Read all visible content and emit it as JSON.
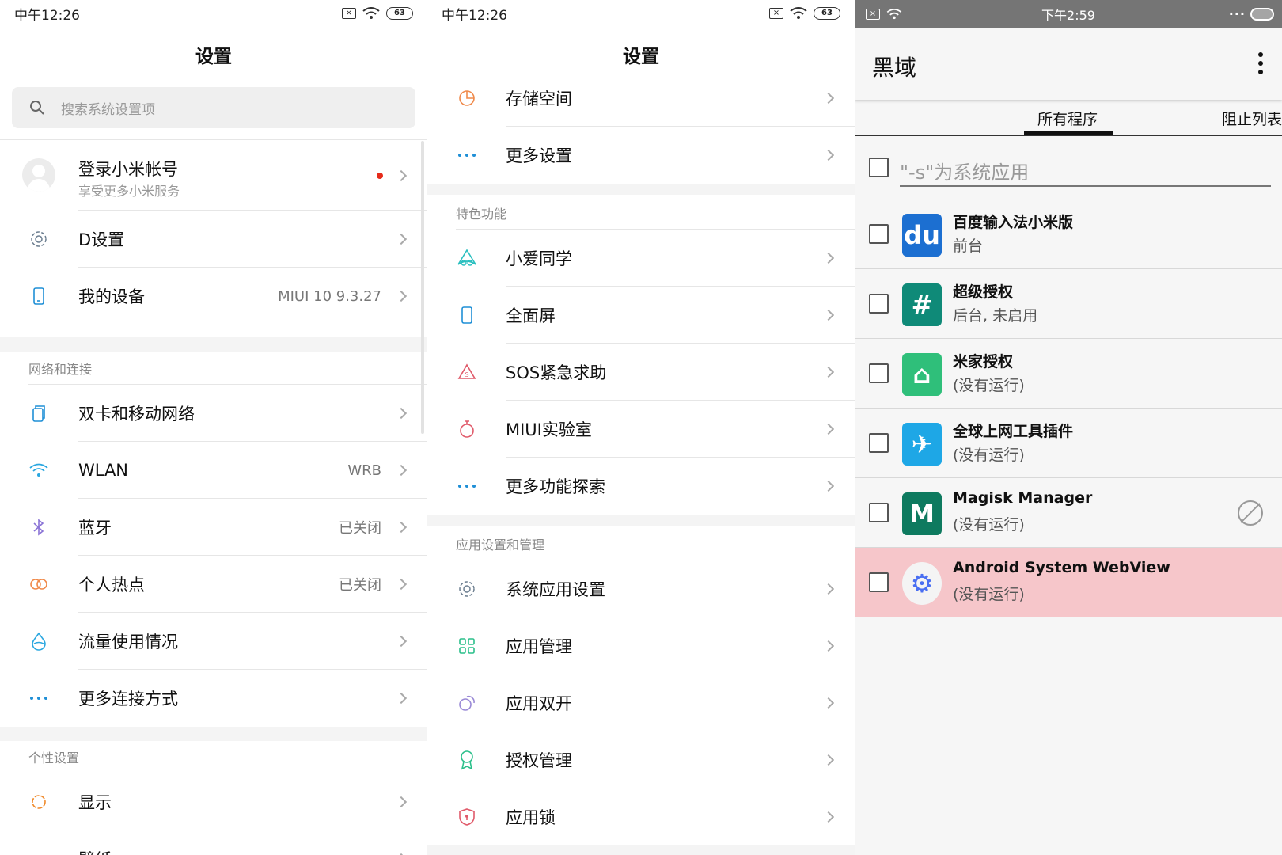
{
  "left": {
    "status_time": "中午12:26",
    "battery": "63",
    "title": "设置",
    "search_placeholder": "搜索系统设置项",
    "account": {
      "title": "登录小米帐号",
      "subtitle": "享受更多小米服务"
    },
    "rows_top": [
      {
        "label": "D设置",
        "value": "",
        "icon": "gear-icon"
      },
      {
        "label": "我的设备",
        "value": "MIUI 10 9.3.27",
        "icon": "phone-icon"
      }
    ],
    "section_network": "网络和连接",
    "network_rows": [
      {
        "label": "双卡和移动网络",
        "value": "",
        "icon": "sim-icon"
      },
      {
        "label": "WLAN",
        "value": "WRB",
        "icon": "wifi-icon"
      },
      {
        "label": "蓝牙",
        "value": "已关闭",
        "icon": "bluetooth-icon"
      },
      {
        "label": "个人热点",
        "value": "已关闭",
        "icon": "hotspot-icon"
      },
      {
        "label": "流量使用情况",
        "value": "",
        "icon": "data-usage-icon"
      },
      {
        "label": "更多连接方式",
        "value": "",
        "icon": "more-dots-icon"
      }
    ],
    "section_personal": "个性设置",
    "personal_rows": [
      {
        "label": "显示",
        "value": "",
        "icon": "brightness-icon"
      },
      {
        "label": "壁纸",
        "value": "",
        "icon": "wallpaper-icon"
      }
    ]
  },
  "middle": {
    "status_time": "中午12:26",
    "battery": "63",
    "title": "设置",
    "rows_top": [
      {
        "label": "存储空间",
        "icon": "storage-icon"
      },
      {
        "label": "更多设置",
        "icon": "more-dots-icon"
      }
    ],
    "section_features": "特色功能",
    "feature_rows": [
      {
        "label": "小爱同学",
        "icon": "xiaoai-icon"
      },
      {
        "label": "全面屏",
        "icon": "fullscreen-icon"
      },
      {
        "label": "SOS紧急求助",
        "icon": "sos-icon"
      },
      {
        "label": "MIUI实验室",
        "icon": "lab-flask-icon"
      },
      {
        "label": "更多功能探索",
        "icon": "more-dots-icon"
      }
    ],
    "section_apps": "应用设置和管理",
    "app_rows": [
      {
        "label": "系统应用设置",
        "icon": "gear-icon"
      },
      {
        "label": "应用管理",
        "icon": "grid-icon"
      },
      {
        "label": "应用双开",
        "icon": "dual-app-icon"
      },
      {
        "label": "授权管理",
        "icon": "permission-icon"
      },
      {
        "label": "应用锁",
        "icon": "shield-lock-icon"
      }
    ]
  },
  "right": {
    "status_time": "下午2:59",
    "app_title": "黑域",
    "tabs": [
      "所有程序",
      "阻止列表"
    ],
    "filter_hint": "\"-s\"为系统应用",
    "apps": [
      {
        "name": "百度输入法小米版",
        "status": "前台",
        "logo": "du",
        "color": "#1c6fd1"
      },
      {
        "name": "超级授权",
        "status": "后台, 未启用",
        "logo": "#",
        "color": "#0f8a78"
      },
      {
        "name": "米家授权",
        "status": "(没有运行)",
        "logo": "⌂",
        "color": "#2fbf7a"
      },
      {
        "name": "全球上网工具插件",
        "status": "(没有运行)",
        "logo": "✈",
        "color": "#1ea7e6"
      },
      {
        "name": "Magisk Manager",
        "status": "(没有运行)",
        "logo": "M",
        "color": "#0e7a5f"
      },
      {
        "name": "Android System WebView",
        "status": "(没有运行)",
        "logo": "⚙",
        "color": "#4a6ff2"
      }
    ],
    "highlight_color": "#f6c6ca"
  }
}
